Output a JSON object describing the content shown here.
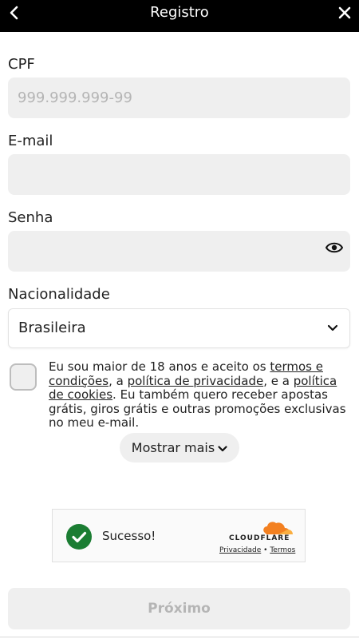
{
  "header": {
    "title": "Registro"
  },
  "icons": {
    "back": "chevron-left-icon",
    "close": "close-icon",
    "eye": "eye-icon",
    "select_chevron": "chevron-down-icon",
    "success": "check-circle-icon",
    "brand_logo": "cloudflare-cloud-logo"
  },
  "form": {
    "cpf": {
      "label": "CPF",
      "placeholder": "999.999.999-99",
      "value": ""
    },
    "email": {
      "label": "E-mail",
      "value": ""
    },
    "password": {
      "label": "Senha",
      "value": ""
    },
    "nationality": {
      "label": "Nacionalidade",
      "value": "Brasileira"
    }
  },
  "terms": {
    "t1": "Eu sou maior de 18 anos e aceito os ",
    "link_terms": "termos e condições",
    "t2": ", a ",
    "link_privacy": "política de privacidade",
    "t3": ", e a ",
    "link_cookies": "política de cookies",
    "t4": ". Eu também quero receber apostas grátis, giros grátis e outras promoções exclusivas no meu e-mail.",
    "checked": false
  },
  "show_more": "Mostrar mais",
  "captcha": {
    "status": "Sucesso!",
    "brand": "CLOUDFLARE",
    "privacy_link": "Privacidade",
    "separator": "•",
    "terms_link": "Termos",
    "accent": "#f38020",
    "success_color": "#1b7d33"
  },
  "next_button": "Próximo"
}
